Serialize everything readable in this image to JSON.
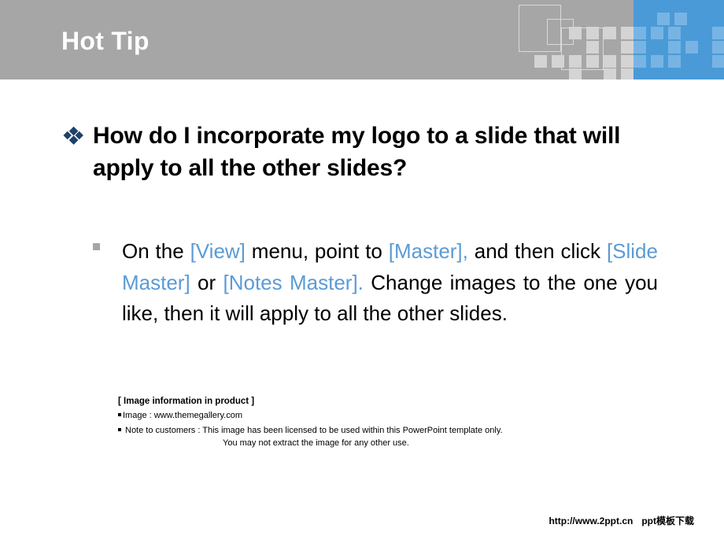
{
  "header": {
    "title": "Hot Tip",
    "background_color": "#a6a6a6",
    "title_color": "#ffffff",
    "accent_panel_color": "#4a9ad8",
    "square_color": "#d4d4d4",
    "blue_square_color": "#78b4e3",
    "outline_color": "#d9d9d9"
  },
  "heading": {
    "bullet_icon": "diamond-cluster-bullet",
    "bullet_color": "#1f4068",
    "line1": "How do I incorporate my logo to a slide",
    "line2": "that will apply to all the other slides?",
    "text": "How do I incorporate my logo to a slide that will apply to all the other slides?"
  },
  "body": {
    "bullet_icon": "square-bullet",
    "bullet_color": "#a6a6a6",
    "highlight_color": "#5b9bd5",
    "segments": [
      {
        "text": "On the ",
        "highlight": false
      },
      {
        "text": "[View]",
        "highlight": true
      },
      {
        "text": " menu, point to ",
        "highlight": false
      },
      {
        "text": "[Master],",
        "highlight": true
      },
      {
        "text": " and then click ",
        "highlight": false
      },
      {
        "text": "[Slide Master]",
        "highlight": true
      },
      {
        "text": " or ",
        "highlight": false
      },
      {
        "text": "[Notes Master].",
        "highlight": true
      },
      {
        "text": " Change images to the one you like, then it will apply to all the other slides.",
        "highlight": false
      }
    ]
  },
  "fineprint": {
    "title": "[ Image information in product ]",
    "line_image": "Image : www.themegallery.com",
    "line_note": "Note to customers : This image has been licensed to be used within this PowerPoint template only.",
    "line_note_cont": "You may not extract the image for any other use."
  },
  "footer": {
    "url": "http://www.2ppt.cn",
    "label": "ppt模板下载"
  }
}
